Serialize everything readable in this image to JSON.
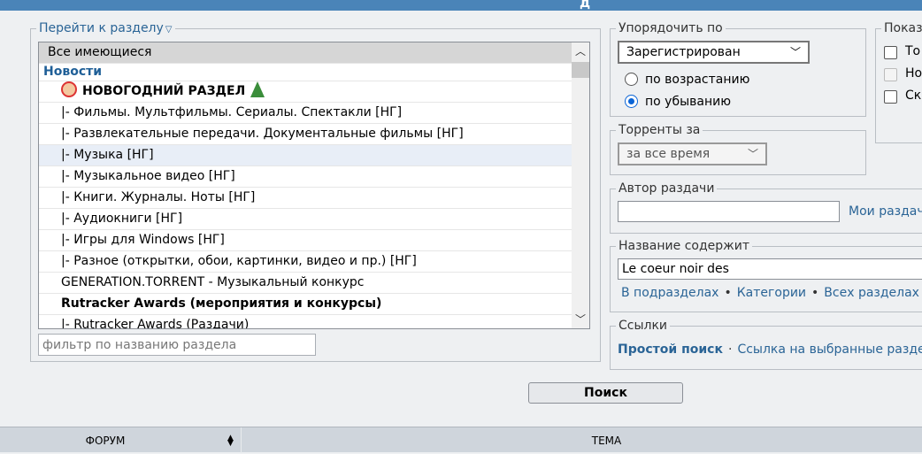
{
  "header": {
    "partial_title": "д"
  },
  "forum_section": {
    "legend": "Перейти к разделу",
    "legend_icon": "triangle-down-icon",
    "items": [
      {
        "label": "Все имеющиеся",
        "type": "selected"
      },
      {
        "label": "Новости",
        "type": "category"
      },
      {
        "label": "НОВОГОДНИЙ РАЗДЕЛ",
        "type": "bold",
        "icons": [
          "santa-icon",
          "tree-icon"
        ]
      },
      {
        "label": "|- Фильмы. Мультфильмы. Сериалы. Спектакли [НГ]",
        "type": "normal"
      },
      {
        "label": "|- Развлекательные передачи. Документальные фильмы [НГ]",
        "type": "normal"
      },
      {
        "label": "|- Музыка [НГ]",
        "type": "hover"
      },
      {
        "label": "|- Музыкальное видео [НГ]",
        "type": "normal"
      },
      {
        "label": "|- Книги. Журналы. Ноты [НГ]",
        "type": "normal"
      },
      {
        "label": "|- Аудиокниги [НГ]",
        "type": "normal"
      },
      {
        "label": "|- Игры для Windows [НГ]",
        "type": "normal"
      },
      {
        "label": "|- Разное (открытки, обои, картинки, видео и пр.) [НГ]",
        "type": "normal"
      },
      {
        "label": "GENERATION.TORRENT - Музыкальный конкурс",
        "type": "normal"
      },
      {
        "label": "Rutracker Awards (мероприятия и конкурсы)",
        "type": "bold"
      },
      {
        "label": "|- Rutracker Awards (Раздачи)",
        "type": "normal"
      }
    ],
    "filter_placeholder": "фильтр по названию раздела"
  },
  "sort": {
    "legend": "Упорядочить по",
    "selected": "Зарегистрирован",
    "asc_label": "по возрастанию",
    "desc_label": "по убыванию",
    "checked": "desc"
  },
  "period": {
    "legend": "Торренты за",
    "selected": "за все время"
  },
  "author": {
    "legend": "Автор раздачи",
    "value": "",
    "my_link": "Мои раздач"
  },
  "title_contains": {
    "legend": "Название содержит",
    "value": "Le coeur noir des",
    "scope_links": [
      "В подразделах",
      "Категории",
      "Всех разделах"
    ]
  },
  "links": {
    "legend": "Ссылки",
    "simple_search": "Простой поиск",
    "selected_link": "Ссылка на выбранные разде"
  },
  "show": {
    "legend": "Показ",
    "options": [
      "То",
      "Но",
      "Ск"
    ]
  },
  "search_button": "Поиск",
  "table": {
    "col_forum": "ФОРУМ",
    "col_topic": "ТЕМА"
  }
}
